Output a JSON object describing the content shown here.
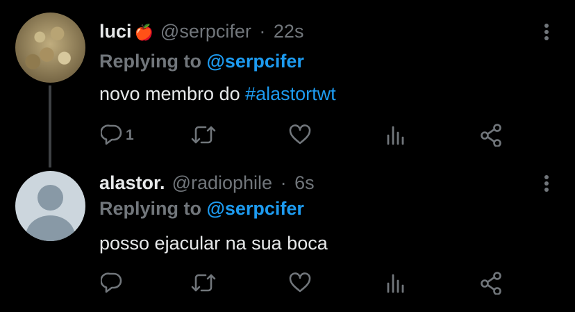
{
  "tweets": [
    {
      "name": "luci",
      "badge_emoji": "🍎",
      "handle": "@serpcifer",
      "separator": "·",
      "time": "22s",
      "replying_prefix": "Replying to",
      "replying_to": "@serpcifer",
      "text_before": "novo membro do ",
      "hashtag": "#alastortwt",
      "reply_count": "1",
      "avatar": "curly-hair-photo"
    },
    {
      "name": "alastor.",
      "handle": "@radiophile",
      "separator": "·",
      "time": "6s",
      "replying_prefix": "Replying to",
      "replying_to": "@serpcifer",
      "text": "posso ejacular na sua boca",
      "reply_count": "",
      "avatar": "default-avatar"
    }
  ],
  "icons": [
    "reply-icon",
    "retweet-icon",
    "like-icon",
    "views-icon",
    "share-icon",
    "more-icon"
  ],
  "colors": {
    "background": "#000000",
    "text": "#e7e9ea",
    "secondary": "#71767b",
    "accent": "#1d9bf0"
  }
}
